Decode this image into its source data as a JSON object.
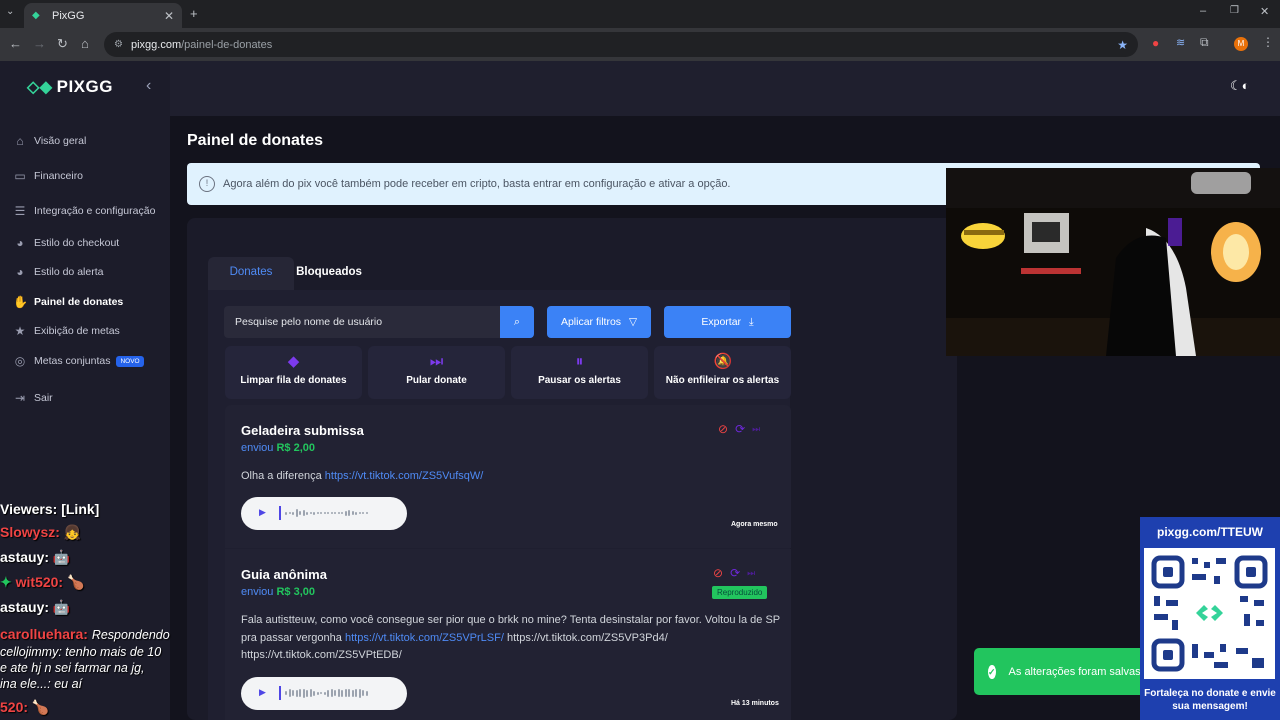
{
  "browser": {
    "tab_title": "PixGG",
    "url_host": "pixgg.com",
    "url_path": "/painel-de-donates",
    "profile_initial": "M"
  },
  "sidebar": {
    "brand": "PIXGG",
    "items": [
      {
        "label": "Visão geral",
        "icon": "home-icon"
      },
      {
        "label": "Financeiro",
        "icon": "wallet-icon"
      },
      {
        "label": "Integração e configuração",
        "icon": "settings-icon"
      },
      {
        "label": "Estilo do checkout",
        "icon": "palette-icon"
      },
      {
        "label": "Estilo do alerta",
        "icon": "palette-icon"
      },
      {
        "label": "Painel de donates",
        "icon": "hand-heart-icon"
      },
      {
        "label": "Exibição de metas",
        "icon": "star-icon"
      },
      {
        "label": "Metas conjuntas",
        "icon": "target-icon",
        "badge": "NOVO"
      },
      {
        "label": "Sair",
        "icon": "logout-icon"
      }
    ]
  },
  "page": {
    "title": "Painel de donates",
    "banner": "Agora além do pix você também pode receber em cripto, basta entrar em configuração e ativar a opção."
  },
  "tabs": [
    "Donates",
    "Bloqueados"
  ],
  "toolbar": {
    "search_placeholder": "Pesquise pelo nome de usuário",
    "filters_label": "Aplicar filtros",
    "export_label": "Exportar"
  },
  "actions": [
    {
      "label": "Limpar fila de donates",
      "icon": "eraser-icon"
    },
    {
      "label": "Pular donate",
      "icon": "skip-icon"
    },
    {
      "label": "Pausar os alertas",
      "icon": "pause-icon"
    },
    {
      "label": "Não enfileirar os alertas",
      "icon": "bell-off-icon"
    }
  ],
  "donates": [
    {
      "name": "Geladeira submissa",
      "sent_prefix": "enviou",
      "amount": "R$ 2,00",
      "message_text": "Olha a diferença",
      "link1": "https://vt.tiktok.com/ZS5VufsqW/",
      "time": "Agora mesmo"
    },
    {
      "name": "Guia anônima",
      "sent_prefix": "enviou",
      "amount": "R$ 3,00",
      "status": "Reproduzido",
      "message_text": "Fala autistteuw, como você consegue ser pior que o brkk no mine? Tenta desinstalar por favor. Voltou la de SP pra passar vergonha",
      "link1": "https://vt.tiktok.com/ZS5VPrLSF/",
      "link2": "https://vt.tiktok.com/ZS5VP3Pd4/",
      "link3": "https://vt.tiktok.com/ZS5VPtEDB/",
      "time": "Há 13 minutos"
    }
  ],
  "chat": {
    "header": "Viewers: [Link]",
    "lines": [
      {
        "name": "Slowysz:",
        "text": ""
      },
      {
        "name": "astauy:",
        "text": ""
      },
      {
        "name": "wit520:",
        "text": ""
      },
      {
        "name": "astauy:",
        "text": ""
      },
      {
        "name": "carolluehara:",
        "text": "Respondendo"
      },
      {
        "name": "",
        "text": "cellojimmy: tenho mais de 10"
      },
      {
        "name": "",
        "text": "e ate hj n sei farmar na jg,"
      },
      {
        "name": "",
        "text": "ina ele...:  eu aí"
      },
      {
        "name": "520:",
        "text": ""
      }
    ]
  },
  "qr": {
    "url": "pixgg.com/TTEUW",
    "caption": "Fortaleça no donate e envie sua mensagem!"
  },
  "toast": "As alterações foram salvas",
  "colors": {
    "accent": "#3b82f6",
    "amount": "#22c55e",
    "brand": "#34d399",
    "danger": "#ef4444"
  }
}
